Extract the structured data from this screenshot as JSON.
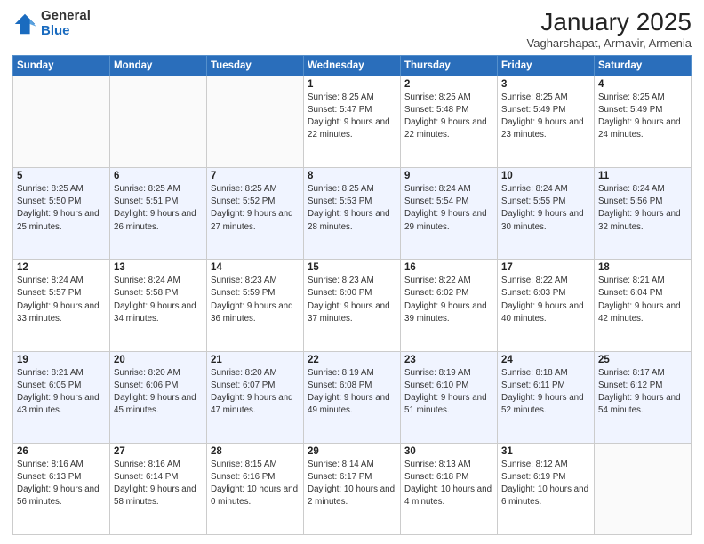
{
  "logo": {
    "general": "General",
    "blue": "Blue"
  },
  "title": "January 2025",
  "location": "Vagharshapat, Armavir, Armenia",
  "weekdays": [
    "Sunday",
    "Monday",
    "Tuesday",
    "Wednesday",
    "Thursday",
    "Friday",
    "Saturday"
  ],
  "weeks": [
    [
      {
        "day": "",
        "sunrise": "",
        "sunset": "",
        "daylight": ""
      },
      {
        "day": "",
        "sunrise": "",
        "sunset": "",
        "daylight": ""
      },
      {
        "day": "",
        "sunrise": "",
        "sunset": "",
        "daylight": ""
      },
      {
        "day": "1",
        "sunrise": "8:25 AM",
        "sunset": "5:47 PM",
        "daylight": "9 hours and 22 minutes."
      },
      {
        "day": "2",
        "sunrise": "8:25 AM",
        "sunset": "5:48 PM",
        "daylight": "9 hours and 22 minutes."
      },
      {
        "day": "3",
        "sunrise": "8:25 AM",
        "sunset": "5:49 PM",
        "daylight": "9 hours and 23 minutes."
      },
      {
        "day": "4",
        "sunrise": "8:25 AM",
        "sunset": "5:49 PM",
        "daylight": "9 hours and 24 minutes."
      }
    ],
    [
      {
        "day": "5",
        "sunrise": "8:25 AM",
        "sunset": "5:50 PM",
        "daylight": "9 hours and 25 minutes."
      },
      {
        "day": "6",
        "sunrise": "8:25 AM",
        "sunset": "5:51 PM",
        "daylight": "9 hours and 26 minutes."
      },
      {
        "day": "7",
        "sunrise": "8:25 AM",
        "sunset": "5:52 PM",
        "daylight": "9 hours and 27 minutes."
      },
      {
        "day": "8",
        "sunrise": "8:25 AM",
        "sunset": "5:53 PM",
        "daylight": "9 hours and 28 minutes."
      },
      {
        "day": "9",
        "sunrise": "8:24 AM",
        "sunset": "5:54 PM",
        "daylight": "9 hours and 29 minutes."
      },
      {
        "day": "10",
        "sunrise": "8:24 AM",
        "sunset": "5:55 PM",
        "daylight": "9 hours and 30 minutes."
      },
      {
        "day": "11",
        "sunrise": "8:24 AM",
        "sunset": "5:56 PM",
        "daylight": "9 hours and 32 minutes."
      }
    ],
    [
      {
        "day": "12",
        "sunrise": "8:24 AM",
        "sunset": "5:57 PM",
        "daylight": "9 hours and 33 minutes."
      },
      {
        "day": "13",
        "sunrise": "8:24 AM",
        "sunset": "5:58 PM",
        "daylight": "9 hours and 34 minutes."
      },
      {
        "day": "14",
        "sunrise": "8:23 AM",
        "sunset": "5:59 PM",
        "daylight": "9 hours and 36 minutes."
      },
      {
        "day": "15",
        "sunrise": "8:23 AM",
        "sunset": "6:00 PM",
        "daylight": "9 hours and 37 minutes."
      },
      {
        "day": "16",
        "sunrise": "8:22 AM",
        "sunset": "6:02 PM",
        "daylight": "9 hours and 39 minutes."
      },
      {
        "day": "17",
        "sunrise": "8:22 AM",
        "sunset": "6:03 PM",
        "daylight": "9 hours and 40 minutes."
      },
      {
        "day": "18",
        "sunrise": "8:21 AM",
        "sunset": "6:04 PM",
        "daylight": "9 hours and 42 minutes."
      }
    ],
    [
      {
        "day": "19",
        "sunrise": "8:21 AM",
        "sunset": "6:05 PM",
        "daylight": "9 hours and 43 minutes."
      },
      {
        "day": "20",
        "sunrise": "8:20 AM",
        "sunset": "6:06 PM",
        "daylight": "9 hours and 45 minutes."
      },
      {
        "day": "21",
        "sunrise": "8:20 AM",
        "sunset": "6:07 PM",
        "daylight": "9 hours and 47 minutes."
      },
      {
        "day": "22",
        "sunrise": "8:19 AM",
        "sunset": "6:08 PM",
        "daylight": "9 hours and 49 minutes."
      },
      {
        "day": "23",
        "sunrise": "8:19 AM",
        "sunset": "6:10 PM",
        "daylight": "9 hours and 51 minutes."
      },
      {
        "day": "24",
        "sunrise": "8:18 AM",
        "sunset": "6:11 PM",
        "daylight": "9 hours and 52 minutes."
      },
      {
        "day": "25",
        "sunrise": "8:17 AM",
        "sunset": "6:12 PM",
        "daylight": "9 hours and 54 minutes."
      }
    ],
    [
      {
        "day": "26",
        "sunrise": "8:16 AM",
        "sunset": "6:13 PM",
        "daylight": "9 hours and 56 minutes."
      },
      {
        "day": "27",
        "sunrise": "8:16 AM",
        "sunset": "6:14 PM",
        "daylight": "9 hours and 58 minutes."
      },
      {
        "day": "28",
        "sunrise": "8:15 AM",
        "sunset": "6:16 PM",
        "daylight": "10 hours and 0 minutes."
      },
      {
        "day": "29",
        "sunrise": "8:14 AM",
        "sunset": "6:17 PM",
        "daylight": "10 hours and 2 minutes."
      },
      {
        "day": "30",
        "sunrise": "8:13 AM",
        "sunset": "6:18 PM",
        "daylight": "10 hours and 4 minutes."
      },
      {
        "day": "31",
        "sunrise": "8:12 AM",
        "sunset": "6:19 PM",
        "daylight": "10 hours and 6 minutes."
      },
      {
        "day": "",
        "sunrise": "",
        "sunset": "",
        "daylight": ""
      }
    ]
  ],
  "labels": {
    "sunrise": "Sunrise:",
    "sunset": "Sunset:",
    "daylight": "Daylight:"
  }
}
